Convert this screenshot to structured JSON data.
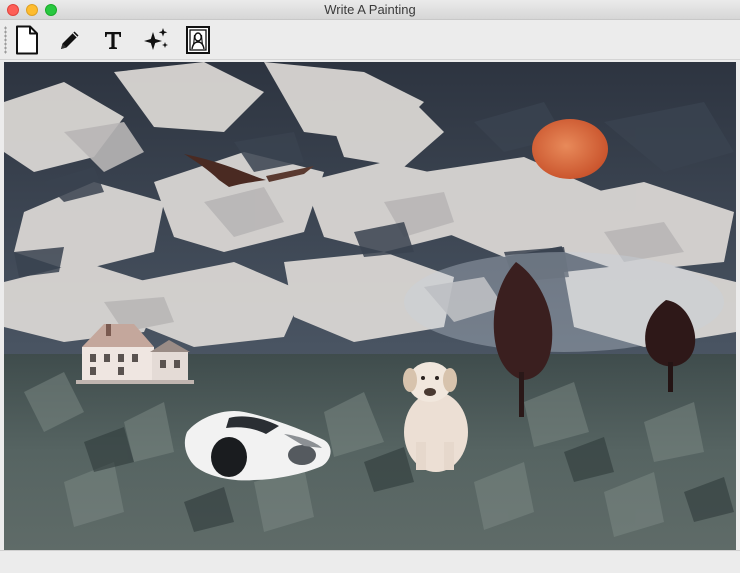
{
  "window": {
    "title": "Write A Painting"
  },
  "toolbar": {
    "tools": [
      {
        "id": "new",
        "icon": "new-document-icon"
      },
      {
        "id": "draw",
        "icon": "pencil-icon"
      },
      {
        "id": "text",
        "icon": "text-icon"
      },
      {
        "id": "magic",
        "icon": "sparkles-icon"
      },
      {
        "id": "style",
        "icon": "portrait-icon"
      }
    ]
  },
  "canvas": {
    "description_visible": false
  }
}
